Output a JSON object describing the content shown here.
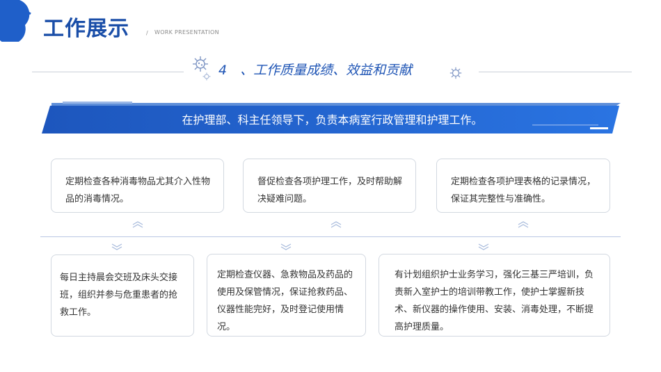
{
  "header": {
    "title": "工作展示",
    "slash": "/",
    "subtitle_en": "WORK PRESENTATION"
  },
  "section": {
    "heading": "4　、工作质量成绩、效益和贡献"
  },
  "banner": {
    "text": "在护理部、科主任领导下，负责本病室行政管理和护理工作。"
  },
  "cards_top": [
    "定期检查各种消毒物品尤其介入性物品的消毒情况。",
    "督促检查各项护理工作，及时帮助解决疑难问题。",
    "定期检查各项护理表格的记录情况，保证其完整性与准确性。"
  ],
  "cards_bottom": [
    "每日主持晨会交班及床头交接班，组织并参与危重患者的抢救工作。",
    "定期检查仪器、急救物品及药品的使用及保管情况，保证抢救药品、仪器性能完好，及时登记使用情况。",
    "有计划组织护士业务学习，强化三基三严培训，负责新入室护士的培训带教工作，使护士掌握新技术、新仪器的操作使用、安装、消毒处理，不断提高护理质量。"
  ],
  "colors": {
    "primary": "#1a4ea8",
    "accent": "#1f6ad8",
    "card_border": "#d2d8e0"
  }
}
